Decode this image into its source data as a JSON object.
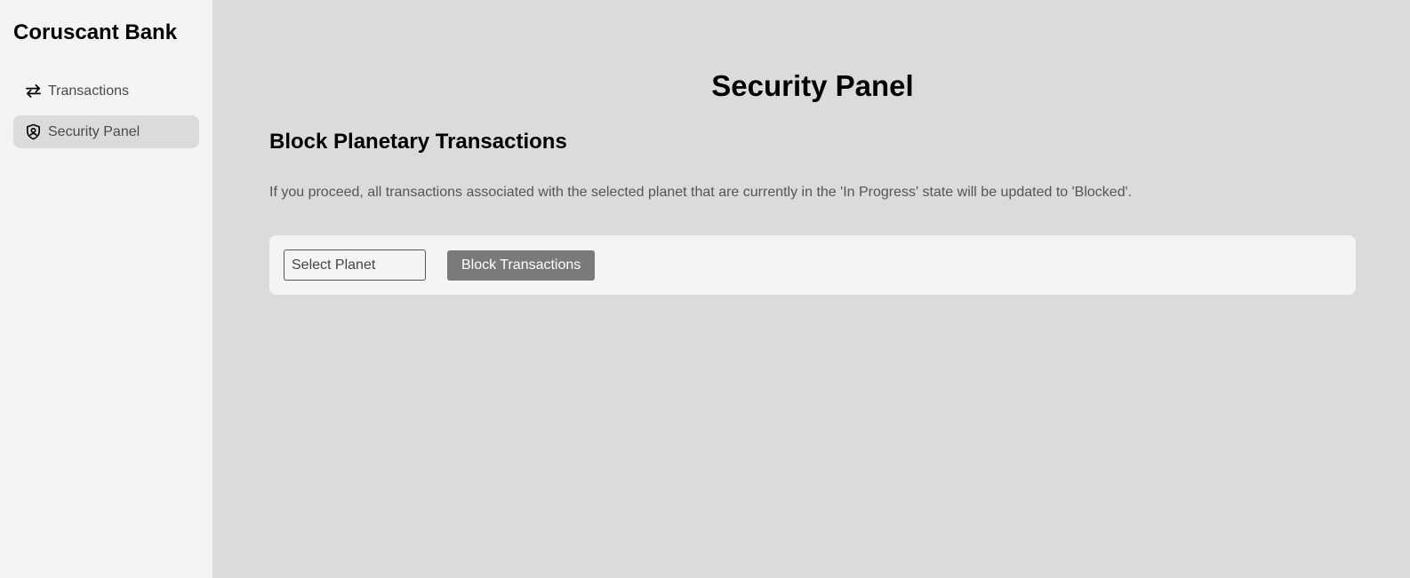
{
  "sidebar": {
    "brand": "Coruscant Bank",
    "items": [
      {
        "label": "Transactions",
        "icon": "arrows-exchange-icon",
        "active": false
      },
      {
        "label": "Security Panel",
        "icon": "shield-user-icon",
        "active": true
      }
    ]
  },
  "main": {
    "title": "Security Panel",
    "section_title": "Block Planetary Transactions",
    "description": "If you proceed, all transactions associated with the selected planet that are currently in the 'In Progress' state will be updated to 'Blocked'.",
    "planet_select": {
      "value": "Select Planet"
    },
    "block_button_label": "Block Transactions"
  },
  "colors": {
    "main_background": "#dcdadb",
    "sidebar_background": "#f4f4f4",
    "button_background": "#7a7a7a"
  }
}
